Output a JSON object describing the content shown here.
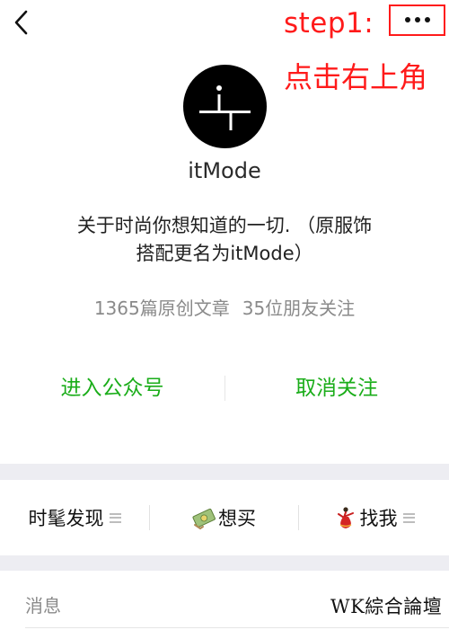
{
  "header": {
    "back_icon": "chevron-left-icon",
    "more_icon": "more-dots-icon",
    "step_label": "step1:",
    "annotation": "点击右上角",
    "annotation_color": "#ff1a1a"
  },
  "account": {
    "name": "itMode",
    "description_line1": "关于时尚你想知道的一切. （原服饰",
    "description_line2": "搭配更名为itMode）",
    "articles": "1365篇原创文章",
    "followers": "35位朋友关注"
  },
  "actions": {
    "enter": "进入公众号",
    "unfollow": "取消关注",
    "accent_color": "#1aad19"
  },
  "menu": {
    "items": [
      {
        "label": "时髦发现",
        "icon": "hamburger-icon"
      },
      {
        "label": "想买",
        "icon": "money-icon"
      },
      {
        "label": "找我",
        "icon": "dancer-icon"
      }
    ]
  },
  "messages": {
    "label": "消息"
  },
  "watermark": "WK綜合論壇"
}
